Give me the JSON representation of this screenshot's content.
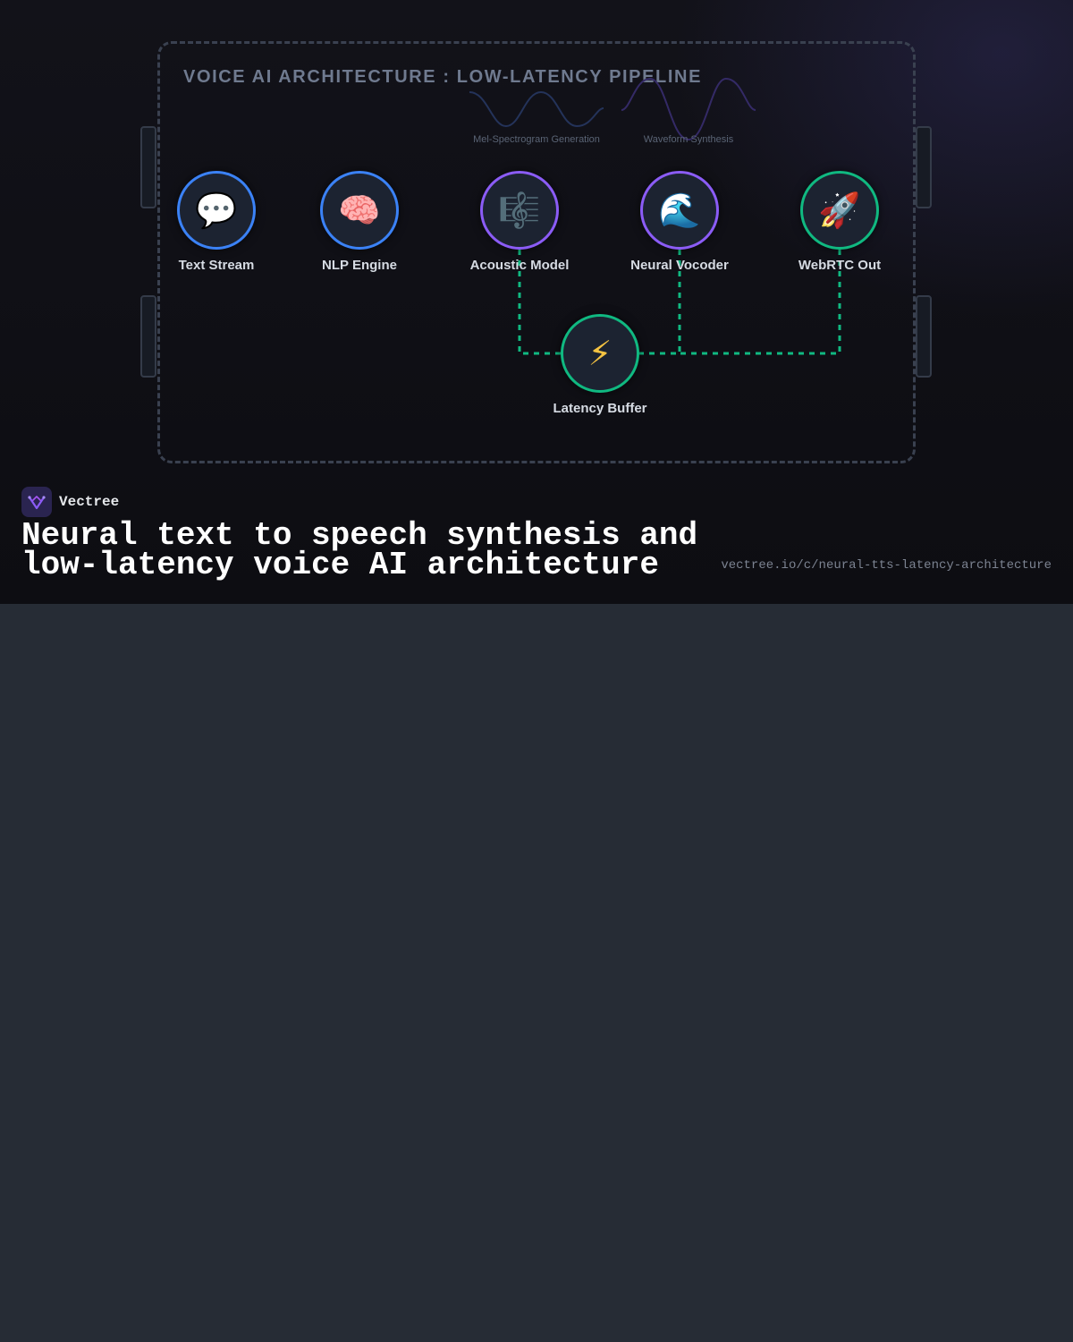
{
  "diagram": {
    "title": "VOICE AI ARCHITECTURE : LOW-LATENCY PIPELINE",
    "stage_captions": {
      "mel": "Mel-Spectrogram Generation",
      "waveform": "Waveform Synthesis"
    },
    "nodes": {
      "text_stream": {
        "label": "Text Stream",
        "icon": "speech-bubble-icon",
        "glyph": "💬",
        "color": "#3b82f6"
      },
      "nlp_engine": {
        "label": "NLP Engine",
        "icon": "brain-icon",
        "glyph": "🧠",
        "color": "#3b82f6"
      },
      "acoustic_model": {
        "label": "Acoustic Model",
        "icon": "music-score-icon",
        "glyph": "🎼",
        "color": "#8b5cf6"
      },
      "neural_vocoder": {
        "label": "Neural Vocoder",
        "icon": "wave-icon",
        "glyph": "🌊",
        "color": "#8b5cf6"
      },
      "webrtc_out": {
        "label": "WebRTC Out",
        "icon": "rocket-icon",
        "glyph": "🚀",
        "color": "#10b981"
      },
      "latency_buffer": {
        "label": "Latency Buffer",
        "icon": "lightning-bolt-icon",
        "glyph": "⚡",
        "color": "#10b981"
      }
    },
    "connector_color": "#10b981"
  },
  "brand": {
    "name": "Vectree",
    "logo_icon": "vectree-logo-icon"
  },
  "page": {
    "title": "Neural text to speech synthesis and low-latency voice AI architecture",
    "url": "vectree.io/c/neural-tts-latency-architecture"
  }
}
